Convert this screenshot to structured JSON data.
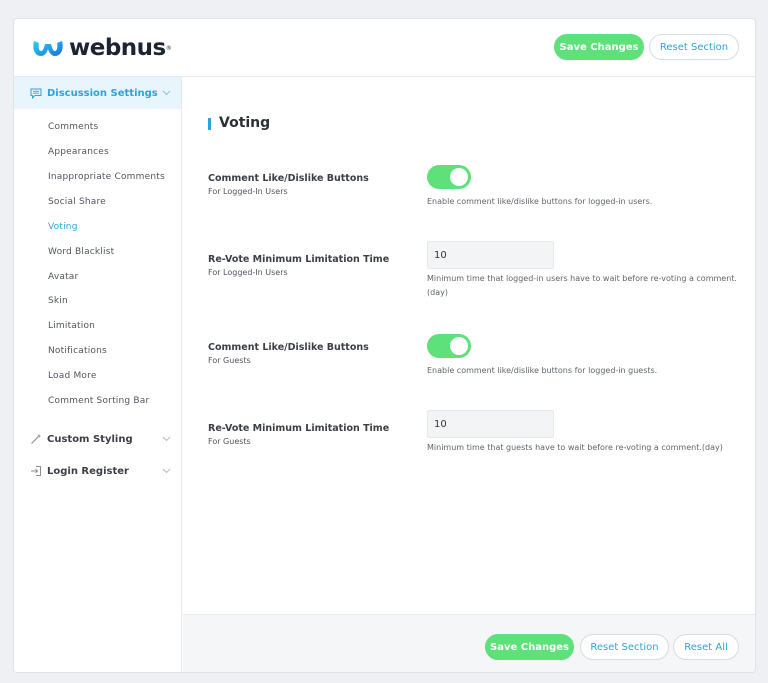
{
  "header": {
    "logo_text": "webnus",
    "logo_reg": "®",
    "save_label": "Save Changes",
    "reset_section_label": "Reset Section"
  },
  "sidebar": {
    "sections": [
      {
        "label": "Discussion Settings",
        "icon": "comment-icon",
        "active": true
      },
      {
        "label": "Custom Styling",
        "icon": "wand-icon",
        "active": false
      },
      {
        "label": "Login Register",
        "icon": "login-icon",
        "active": false
      }
    ],
    "items": [
      {
        "label": "Comments"
      },
      {
        "label": "Appearances"
      },
      {
        "label": "Inappropriate Comments"
      },
      {
        "label": "Social Share"
      },
      {
        "label": "Voting",
        "active": true
      },
      {
        "label": "Word Blacklist"
      },
      {
        "label": "Avatar"
      },
      {
        "label": "Skin"
      },
      {
        "label": "Limitation"
      },
      {
        "label": "Notifications"
      },
      {
        "label": "Load More"
      },
      {
        "label": "Comment Sorting Bar"
      }
    ]
  },
  "main": {
    "title": "Voting",
    "fields": [
      {
        "title": "Comment Like/Dislike Buttons",
        "subtitle": "For Logged-In Users",
        "type": "toggle",
        "on": true,
        "desc": "Enable comment like/dislike buttons for logged-in users."
      },
      {
        "title": "Re-Vote Minimum Limitation Time",
        "subtitle": "For Logged-In Users",
        "type": "input",
        "value": "10",
        "desc": "Minimum time that logged-in users have to wait before re-voting a comment.(day)"
      },
      {
        "title": "Comment Like/Dislike Buttons",
        "subtitle": "For Guests",
        "type": "toggle",
        "on": true,
        "desc": "Enable comment like/dislike buttons for logged-in guests."
      },
      {
        "title": "Re-Vote Minimum Limitation Time",
        "subtitle": "For Guests",
        "type": "input",
        "value": "10",
        "desc": "Minimum time that guests have to wait before re-voting a comment.(day)"
      }
    ]
  },
  "footer": {
    "save_label": "Save Changes",
    "reset_section_label": "Reset Section",
    "reset_all_label": "Reset All"
  },
  "colors": {
    "accent": "#2ea3d6",
    "green": "#5ee07a",
    "active_bg": "#e9f5fc"
  }
}
